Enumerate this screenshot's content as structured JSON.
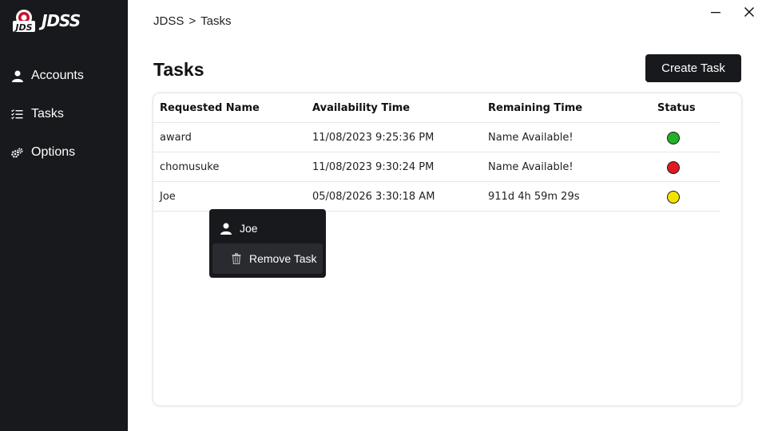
{
  "app": {
    "logo_text": "JDSS"
  },
  "sidebar": {
    "items": [
      {
        "label": "Accounts",
        "icon": "user-icon"
      },
      {
        "label": "Tasks",
        "icon": "task-list-icon"
      },
      {
        "label": "Options",
        "icon": "gears-icon"
      }
    ]
  },
  "header": {
    "breadcrumb_root": "JDSS",
    "breadcrumb_sep": ">",
    "breadcrumb_current": "Tasks",
    "minimize_glyph": "—",
    "close_glyph": "✕"
  },
  "main": {
    "title": "Tasks",
    "create_button": "Create Task"
  },
  "table": {
    "columns": [
      "Requested Name",
      "Availability Time",
      "Remaining Time",
      "Status"
    ],
    "rows": [
      {
        "name": "award",
        "availability": "11/08/2023 9:25:36 PM",
        "remaining": "Name Available!",
        "status_color": "#22b22a"
      },
      {
        "name": "chomusuke",
        "availability": "11/08/2023 9:30:24 PM",
        "remaining": "Name Available!",
        "status_color": "#e01a22"
      },
      {
        "name": "Joe",
        "availability": "05/08/2026 3:30:18 AM",
        "remaining": "911d 4h 59m 29s",
        "status_color": "#f2e200"
      }
    ]
  },
  "context_menu": {
    "title": "Joe",
    "item": "Remove Task"
  },
  "colors": {
    "sidebar_bg": "#18191d",
    "accent_dark": "#18191d"
  }
}
